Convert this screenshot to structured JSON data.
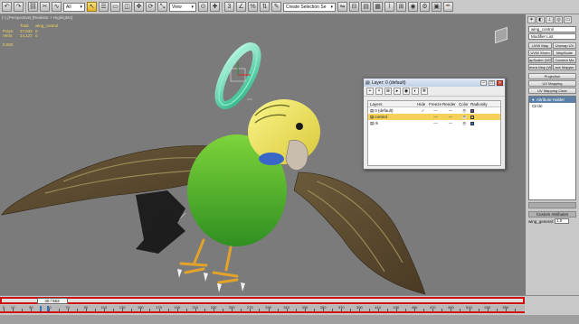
{
  "toolbar": {
    "filter_select": "All",
    "view_select": "View",
    "selection_set": "Create Selection Se"
  },
  "viewport": {
    "label": "[+] [Perspective] [Realistic + Highlights]",
    "stats": {
      "headers": [
        "",
        "Total",
        "wing_control"
      ],
      "rows": [
        [
          "Polys:",
          "27,532",
          "0"
        ],
        [
          "Verts:",
          "14,127",
          "0"
        ]
      ],
      "fps": "0.000"
    }
  },
  "layer_dialog": {
    "title": "Layer: 0 (default)",
    "columns": [
      "Layers",
      "Hide",
      "Freeze",
      "Render",
      "Color",
      "Radiosity"
    ],
    "rows": [
      {
        "name": "0 (default)",
        "check": "✓",
        "hide": "—",
        "freeze": "—",
        "color": "#7a3aa8",
        "selected": false
      },
      {
        "name": "control",
        "check": "",
        "hide": "—",
        "freeze": "—",
        "color": "#e8c020",
        "selected": true
      },
      {
        "name": "rk",
        "check": "",
        "hide": "—",
        "freeze": "—",
        "color": "#3a6fd0",
        "selected": false
      }
    ]
  },
  "command_panel": {
    "object_name": "wing_control",
    "modifier_list": "Modifier List",
    "buttons": [
      [
        "UVW Map",
        "Unwrap UV"
      ],
      [
        "UVW Xform",
        "MapScale"
      ],
      [
        "apScaler (WSM",
        "Camera Ma"
      ],
      [
        "mera Map (WS",
        "ace Mapper"
      ]
    ],
    "wide_buttons": [
      "Projection",
      "UV Mapping",
      "UV Mapping Clear",
      "dect By Cha"
    ],
    "stack": [
      {
        "label": "Attribute Holder",
        "selected": true
      },
      {
        "label": "Circle",
        "selected": false
      }
    ],
    "rollout": "Custom Attributes",
    "param": {
      "label": "wing_general:",
      "value": "1,0"
    }
  },
  "timeline": {
    "frame_display": "40 / 563",
    "current_frame": 40,
    "max_frame": 563,
    "ticks": [
      "0",
      "10",
      "20",
      "30",
      "40",
      "50",
      "60",
      "70",
      "80",
      "90",
      "100",
      "110",
      "120",
      "130",
      "140",
      "150",
      "160",
      "170",
      "180",
      "190",
      "200",
      "210",
      "220",
      "230",
      "240",
      "250",
      "260",
      "270",
      "280",
      "290",
      "300",
      "310",
      "320",
      "330",
      "340",
      "350",
      "360",
      "370",
      "380",
      "390",
      "400",
      "410",
      "420",
      "430",
      "440",
      "450",
      "460",
      "470",
      "480",
      "490",
      "500",
      "510",
      "520",
      "530",
      "540",
      "550",
      "560"
    ],
    "keys": [
      40,
      48
    ]
  },
  "colors": {
    "accent": "#d10e0e",
    "selection": "#f5d15a",
    "gizmo": "#4fe3b0"
  }
}
